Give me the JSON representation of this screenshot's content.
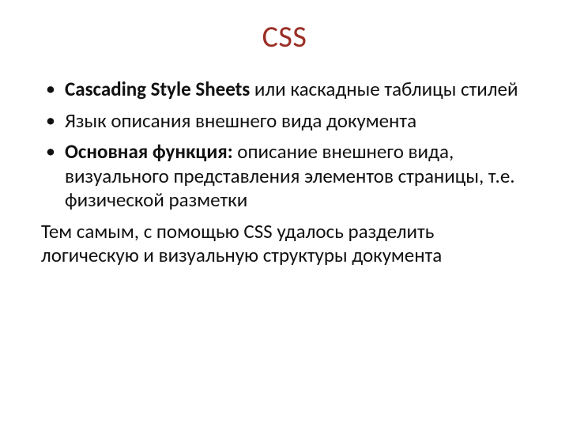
{
  "title": "CSS",
  "bullets": [
    {
      "bold": "Cascading Style Sheets",
      "rest": " или каскадные таблицы стилей"
    },
    {
      "bold": "",
      "rest": "Язык описания внешнего вида документа"
    },
    {
      "bold": "Основная функция:",
      "rest": " описание внешнего вида, визуального представления элементов страницы, т.е. физической разметки"
    }
  ],
  "closing": "Тем самым, с помощью CSS удалось разделить логическую и визуальную структуры документа"
}
